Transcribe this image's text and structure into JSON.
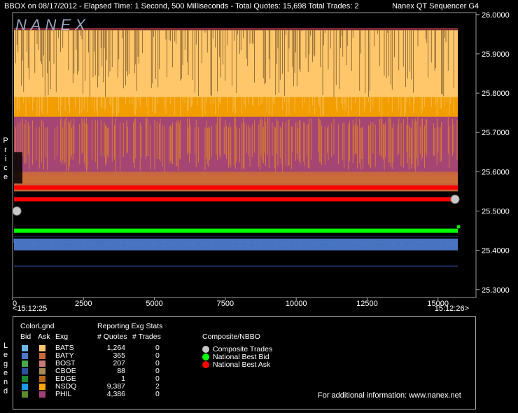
{
  "header": {
    "title": "BBOX on 08/17/2012  -  Elapsed Time: 1 Second, 500 Milliseconds  -  Total Quotes: 15,698  Total Trades: 2",
    "sequencer": "Nanex QT Sequencer G4",
    "logo": "NANEX"
  },
  "chart_data": {
    "type": "line",
    "ylabel": "Price",
    "y_ticks": [
      "26.0000",
      "25.9000",
      "25.8000",
      "25.7000",
      "25.6000",
      "25.5000",
      "25.4000",
      "25.3000"
    ],
    "y_tick_values": [
      26.0,
      25.9,
      25.8,
      25.7,
      25.6,
      25.5,
      25.4,
      25.3
    ],
    "ylim": [
      25.28,
      26.005
    ],
    "x_ticks": [
      "0",
      "2500",
      "5000",
      "7500",
      "10000",
      "12500",
      "15000"
    ],
    "x_tick_values": [
      0,
      2500,
      5000,
      7500,
      10000,
      12500,
      15000
    ],
    "xlim": [
      0,
      15698
    ],
    "x_start_label": "<15:12:25",
    "x_end_label": "15:12:26>",
    "series": [
      {
        "name": "National Best Ask",
        "color": "#ff0000",
        "values": [
          25.53,
          25.56
        ]
      },
      {
        "name": "National Best Bid",
        "color": "#00ff00",
        "values": [
          25.45
        ]
      },
      {
        "name": "Composite Trades",
        "color": "#c8c8c8",
        "x": [
          150,
          15600
        ],
        "values": [
          25.5,
          25.53
        ]
      }
    ],
    "quote_bands": [
      {
        "name": "NSDQ ask",
        "color": "#ffa500",
        "from": 25.57,
        "to": 25.96
      },
      {
        "name": "BATS ask",
        "color": "#ffc870",
        "from": 25.79,
        "to": 25.96
      },
      {
        "name": "PHIL ask",
        "color": "#a0407a",
        "from": 25.59,
        "to": 25.74
      },
      {
        "name": "BATY ask",
        "color": "#c86a3c",
        "from": 25.55,
        "to": 25.6
      },
      {
        "name": "bid quotes",
        "color": "#4a78c8",
        "from": 25.4,
        "to": 25.43
      }
    ]
  },
  "legend": {
    "axis_label": "Legend",
    "colorlgnd": "ColorLgnd",
    "bid": "Bid",
    "ask": "Ask",
    "exg": "Exg",
    "stats_title": "Reporting Exg Stats",
    "quotes_header": "# Quotes",
    "trades_header": "# Trades",
    "composite_title": "Composite/NBBO",
    "rows": [
      {
        "exg": "BATS",
        "quotes": "1,264",
        "trades": "0",
        "bid_color": "#6ab4e8",
        "ask_color": "#ffc870"
      },
      {
        "exg": "BATY",
        "quotes": "365",
        "trades": "0",
        "bid_color": "#4a78c8",
        "ask_color": "#c86a3c"
      },
      {
        "exg": "BOST",
        "quotes": "207",
        "trades": "0",
        "bid_color": "#4aa84a",
        "ask_color": "#c87a78"
      },
      {
        "exg": "CBOE",
        "quotes": "88",
        "trades": "0",
        "bid_color": "#2a50a0",
        "ask_color": "#a88a58"
      },
      {
        "exg": "EDGE",
        "quotes": "1",
        "trades": "0",
        "bid_color": "#1a8a2a",
        "ask_color": "#b86818"
      },
      {
        "exg": "NSDQ",
        "quotes": "9,387",
        "trades": "2",
        "bid_color": "#1a9ae8",
        "ask_color": "#ffa500"
      },
      {
        "exg": "PHIL",
        "quotes": "4,386",
        "trades": "0",
        "bid_color": "#5a8a2a",
        "ask_color": "#a0407a"
      }
    ],
    "composite": [
      {
        "label": "Composite Trades",
        "color": "#c8c8c8"
      },
      {
        "label": "National Best Bid",
        "color": "#00ff00"
      },
      {
        "label": "National Best Ask",
        "color": "#ff0000"
      }
    ],
    "footer": "For additional information: www.nanex.net"
  }
}
